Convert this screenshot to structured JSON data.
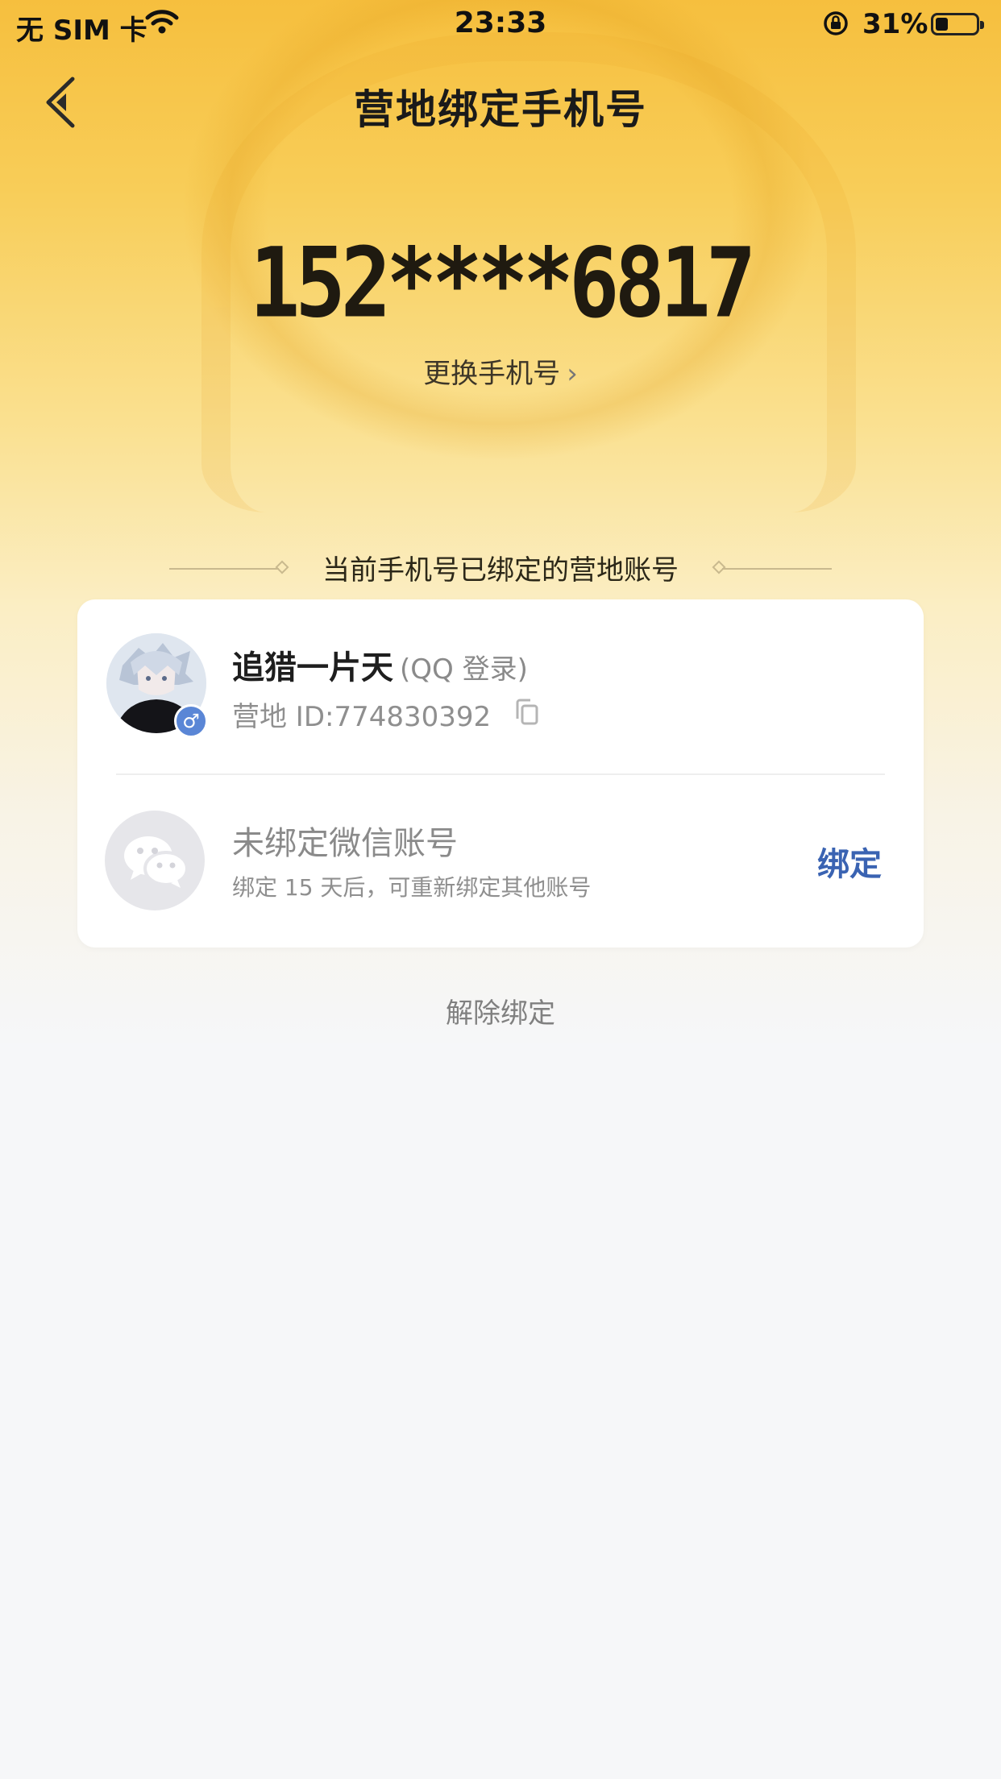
{
  "status_bar": {
    "carrier": "无 SIM 卡",
    "time": "23:33",
    "battery_pct": "31%",
    "battery_level": 0.31
  },
  "nav": {
    "title": "营地绑定手机号"
  },
  "phone": {
    "number": "152****6817",
    "change_label": "更换手机号"
  },
  "section": {
    "title": "当前手机号已绑定的营地账号"
  },
  "accounts": {
    "qq": {
      "name": "追猎一片天",
      "login_via": "(QQ 登录)",
      "camp_id": "营地 ID:774830392",
      "gender": "♂"
    },
    "wechat": {
      "title": "未绑定微信账号",
      "subtitle": "绑定 15 天后，可重新绑定其他账号",
      "bind_label": "绑定"
    }
  },
  "unbind_label": "解除绑定",
  "colors": {
    "accent_blue": "#3a63b2",
    "gender_badge": "#5a86d6",
    "hero_gold": "#f6bf3e"
  }
}
